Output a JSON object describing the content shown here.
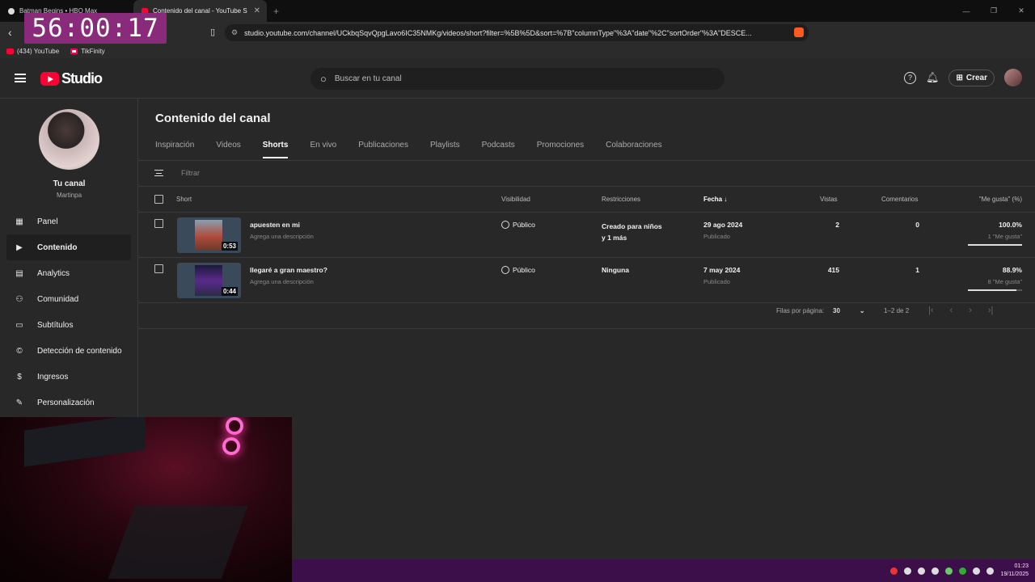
{
  "browser": {
    "tabs": [
      {
        "label": "Batman Begins • HBO Max",
        "active": false
      },
      {
        "label": "Contenido del canal - YouTube S",
        "active": true
      }
    ],
    "url": "studio.youtube.com/channel/UCkbqSqvQpgLavo6IC35NMKg/videos/short?filter=%5B%5D&sort=%7B\"columnType\"%3A\"date\"%2C\"sortOrder\"%3A\"DESCE...",
    "bookmarks": [
      "(434) YouTube",
      "TikFinity"
    ]
  },
  "overlay": {
    "timer": "56:00:17"
  },
  "header": {
    "logo_text": "Studio",
    "search_placeholder": "Buscar en tu canal",
    "create_label": "Crear"
  },
  "sidebar": {
    "channel_title": "Tu canal",
    "channel_name": "Martinpa",
    "items": [
      {
        "label": "Panel",
        "icon": "dashboard-icon"
      },
      {
        "label": "Contenido",
        "icon": "content-icon",
        "active": true
      },
      {
        "label": "Analytics",
        "icon": "analytics-icon"
      },
      {
        "label": "Comunidad",
        "icon": "community-icon"
      },
      {
        "label": "Subtítulos",
        "icon": "subtitles-icon"
      },
      {
        "label": "Detección de contenido",
        "icon": "copyright-icon"
      },
      {
        "label": "Ingresos",
        "icon": "dollar-icon"
      },
      {
        "label": "Personalización",
        "icon": "wand-icon"
      }
    ]
  },
  "main": {
    "title": "Contenido del canal",
    "tabs": [
      "Inspiración",
      "Videos",
      "Shorts",
      "En vivo",
      "Publicaciones",
      "Playlists",
      "Podcasts",
      "Promociones",
      "Colaboraciones"
    ],
    "active_tab": "Shorts",
    "filter_placeholder": "Filtrar",
    "columns": {
      "short": "Short",
      "visibility": "Visibilidad",
      "restrictions": "Restricciones",
      "date": "Fecha",
      "views": "Vistas",
      "comments": "Comentarios",
      "likes": "\"Me gusta\" (%)"
    },
    "rows": [
      {
        "title": "apuesten en mi",
        "description": "Agrega una descripción",
        "duration": "0:53",
        "visibility": "Público",
        "restriction_line1": "Creado para niños",
        "restriction_line2": "y 1 más",
        "date": "29 ago 2024",
        "status": "Publicado",
        "views": "2",
        "comments": "0",
        "likes_pct": "100.0%",
        "likes_count": "1 \"Me gusta\"",
        "likes_fraction": 1.0
      },
      {
        "title": "llegaré a gran maestro?",
        "description": "Agrega una descripción",
        "duration": "0:44",
        "visibility": "Público",
        "restriction_line1": "Ninguna",
        "restriction_line2": "",
        "date": "7 may 2024",
        "status": "Publicado",
        "views": "415",
        "comments": "1",
        "likes_pct": "88.9%",
        "likes_count": "8 \"Me gusta\"",
        "likes_fraction": 0.889
      }
    ],
    "pagination": {
      "rows_per_page_label": "Filas por página:",
      "rows_per_page": "30",
      "range": "1–2 de 2"
    }
  },
  "taskbar": {
    "time": "01:23",
    "date": "19/11/2025"
  },
  "colors": {
    "brand": "#ff0033",
    "background": "#282828",
    "taskbar": "#3c0e4a",
    "timer_bg": "#8a2a7a"
  }
}
